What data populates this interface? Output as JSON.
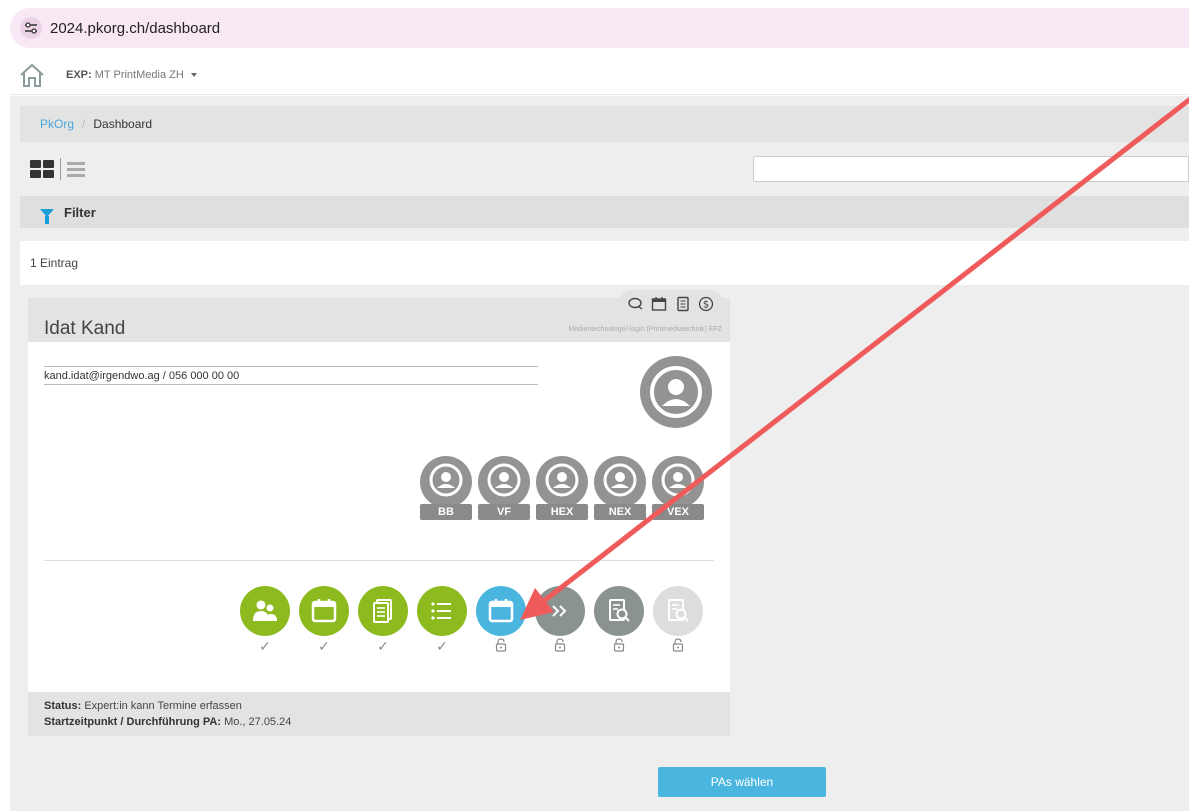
{
  "browser": {
    "url": "2024.pkorg.ch/dashboard"
  },
  "appbar": {
    "exp_label": "EXP:",
    "exp_value": "MT PrintMedia ZH"
  },
  "breadcrumb": {
    "root": "PkOrg",
    "separator": "/",
    "current": "Dashboard"
  },
  "search": {
    "value": "",
    "placeholder": ""
  },
  "filter": {
    "label": "Filter"
  },
  "count": {
    "text": "1 Eintrag"
  },
  "card": {
    "name": "Idat Kand",
    "profession": "Medientechnologe/-login (Printmediatechnik) EFZ",
    "contact": "kand.idat@irgendwo.ag / 056 000 00 00",
    "header_icons": [
      "chat-icon",
      "calendar-icon",
      "document-icon",
      "dollar-icon"
    ],
    "roles": [
      {
        "label": "BB"
      },
      {
        "label": "VF"
      },
      {
        "label": "HEX"
      },
      {
        "label": "NEX"
      },
      {
        "label": "VEX"
      }
    ],
    "steps": [
      {
        "icon": "people-icon",
        "state": "done",
        "mark": "✓",
        "color": "#8dba1e"
      },
      {
        "icon": "calendar-icon",
        "state": "done",
        "mark": "✓",
        "color": "#8dba1e"
      },
      {
        "icon": "documents-icon",
        "state": "done",
        "mark": "✓",
        "color": "#8dba1e"
      },
      {
        "icon": "list-icon",
        "state": "done",
        "mark": "✓",
        "color": "#8dba1e"
      },
      {
        "icon": "calendar-icon",
        "state": "active",
        "mark": "lock",
        "color": "#4ab6e0"
      },
      {
        "icon": "double-chevron-icon",
        "state": "locked",
        "mark": "lock",
        "color": "#8b9292"
      },
      {
        "icon": "document-search-icon",
        "state": "locked",
        "mark": "lock",
        "color": "#8b9292"
      },
      {
        "icon": "document-search-icon",
        "state": "locked",
        "mark": "lock",
        "color": "#dcdedd"
      }
    ],
    "status_label": "Status:",
    "status_value": "Expert:in kann Termine erfassen",
    "start_label": "Startzeitpunkt / Durchführung PA:",
    "start_value": "Mo., 27.05.24"
  },
  "actions": {
    "choose_button": "PAs wählen"
  },
  "colors": {
    "accent_green": "#8dba1e",
    "accent_blue": "#4ab6e0",
    "annotation_arrow": "#ef5a5a"
  }
}
